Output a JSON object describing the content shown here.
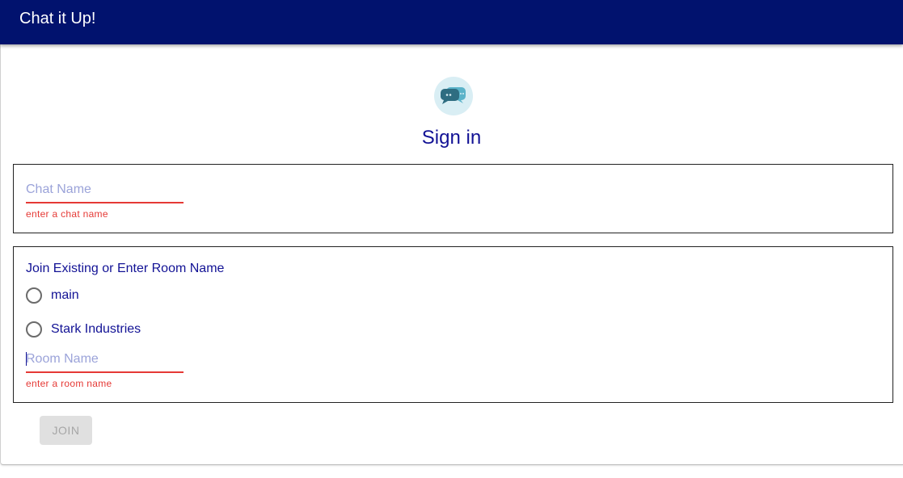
{
  "appbar": {
    "title": "Chat it Up!"
  },
  "signin": {
    "avatar_icon": "chat-bubbles-icon",
    "title": "Sign in"
  },
  "chat_name": {
    "placeholder": "Chat Name",
    "value": "",
    "helper": "enter a chat name"
  },
  "room": {
    "group_label": "Join Existing or Enter Room Name",
    "options": [
      {
        "label": "main",
        "selected": false
      },
      {
        "label": "Stark Industries",
        "selected": false
      }
    ],
    "placeholder": "Room Name",
    "value": "",
    "helper": "enter a room name"
  },
  "join_button": {
    "label": "JOIN",
    "disabled": true
  },
  "colors": {
    "appbar": "#01126e",
    "accent_text": "#121295",
    "error": "#e53935",
    "avatar_bg": "#d9eef4"
  }
}
